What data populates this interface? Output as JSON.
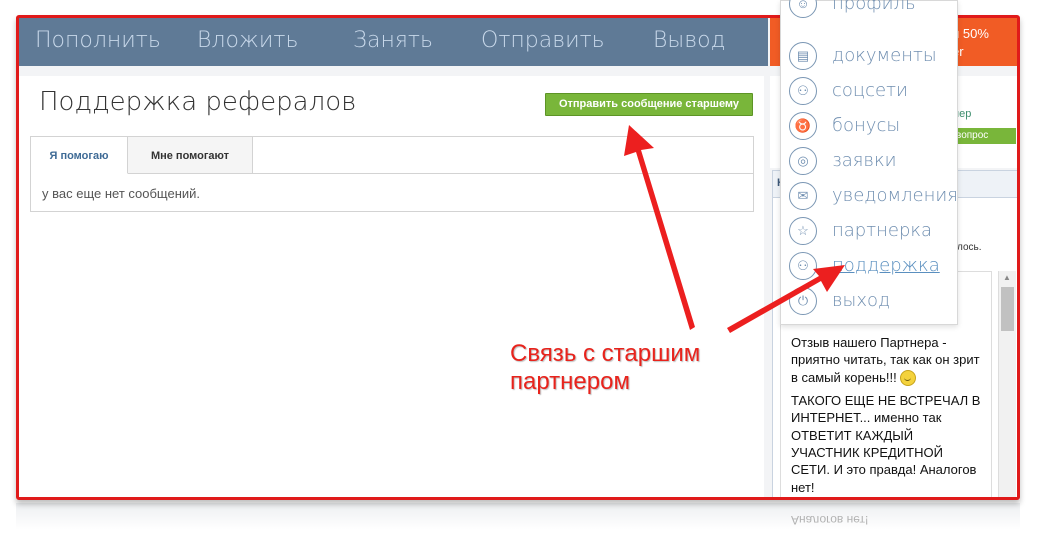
{
  "nav": {
    "items": [
      "Пополнить",
      "Вложить",
      "Занять",
      "Отправить",
      "Вывод"
    ]
  },
  "main": {
    "title": "Поддержка рефералов",
    "send_button": "Отправить сообщение старшему",
    "tabs": [
      {
        "label": "Я помогаю",
        "active": true
      },
      {
        "label": "Мне помогают",
        "active": false
      }
    ],
    "empty_message": "у вас еще нет сообщений."
  },
  "sidebar": {
    "promo_line1": "й 50%",
    "promo_line2": "er",
    "partner_text": "нер",
    "question_button": "вопрос",
    "widget_header": "Н",
    "widget_text": "лось."
  },
  "dropdown": {
    "items": [
      {
        "label": "профиль",
        "icon": "person-icon"
      },
      {
        "label": "документы",
        "icon": "document-icon"
      },
      {
        "label": "соцсети",
        "icon": "people-icon"
      },
      {
        "label": "бонусы",
        "icon": "piggy-bank-icon"
      },
      {
        "label": "заявки",
        "icon": "coins-icon"
      },
      {
        "label": "уведомления",
        "icon": "envelope-icon"
      },
      {
        "label": "партнерка",
        "icon": "star-icon"
      },
      {
        "label": "поддержка",
        "icon": "users-icon",
        "active": true
      },
      {
        "label": "выход",
        "icon": "power-icon"
      }
    ]
  },
  "post": {
    "paragraph1": "Отзыв нашего Партнера - приятно читать, так как он зрит в самый корень!!!",
    "paragraph2": "ТАКОГО ЕЩЕ НЕ ВСТРЕЧАЛ В ИНТЕРНЕТ... именно так ОТВЕТИТ КАЖДЫЙ УЧАСТНИК КРЕДИТНОЙ СЕТИ. И это правда! Аналогов нет!",
    "reflection_text": "Аналогов нет!"
  },
  "annotation": {
    "line1": "Связь с старшим",
    "line2": "партнером"
  },
  "colors": {
    "nav_bg": "#5f7a96",
    "accent_green": "#79b63a",
    "highlight_red": "#e01a1a",
    "promo_orange": "#f15c25"
  }
}
